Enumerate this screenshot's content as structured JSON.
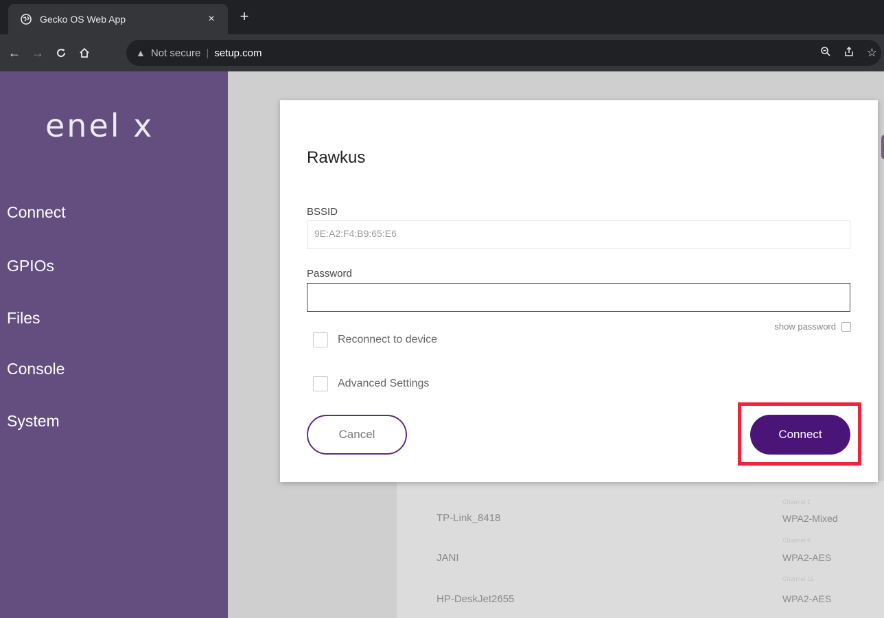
{
  "browser": {
    "tab_title": "Gecko OS Web App",
    "tab_close": "×",
    "new_tab": "+",
    "security_text": "Not secure",
    "separator": "|",
    "host": "setup.com"
  },
  "sidebar": {
    "logo": "enel x",
    "items": [
      {
        "label": "Connect"
      },
      {
        "label": "GPIOs"
      },
      {
        "label": "Files"
      },
      {
        "label": "Console"
      },
      {
        "label": "System"
      }
    ]
  },
  "modal": {
    "title": "Rawkus",
    "bssid_label": "BSSID",
    "bssid_value": "9E:A2:F4:B9:65:E6",
    "password_label": "Password",
    "password_value": "",
    "show_password_label": "show password",
    "reconnect_label": "Reconnect to device",
    "advanced_label": "Advanced Settings",
    "cancel_label": "Cancel",
    "connect_label": "Connect"
  },
  "networks": [
    {
      "channel": "Channel 1",
      "name": "TP-Link_8418",
      "security": "WPA2-Mixed"
    },
    {
      "channel": "Channel 9",
      "name": "JANI",
      "security": "WPA2-AES"
    },
    {
      "channel": "Channel 11",
      "name": "HP-DeskJet2655",
      "security": "WPA2-AES"
    }
  ],
  "colors": {
    "sidebar": "#644e80",
    "accent": "#4a1479",
    "highlight": "#f0233a"
  }
}
